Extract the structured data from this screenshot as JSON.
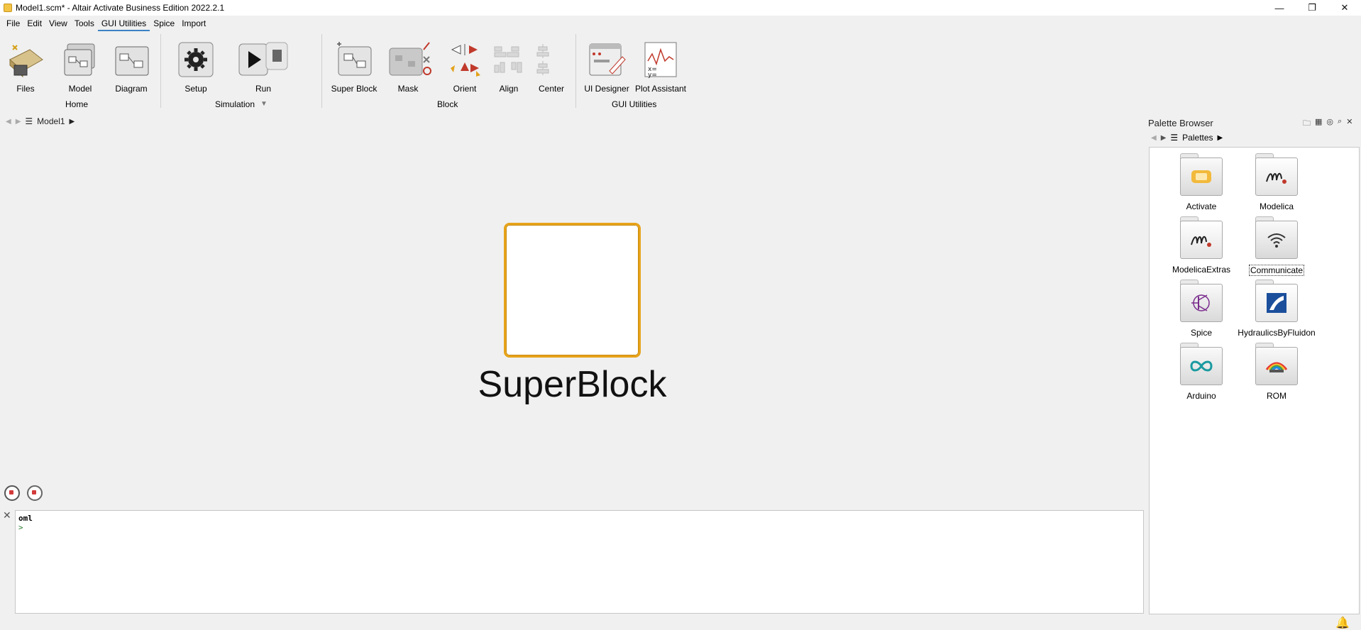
{
  "window": {
    "title": "Model1.scm* - Altair Activate Business Edition 2022.2.1",
    "controls": [
      "minimize-icon",
      "restore-icon",
      "close-icon"
    ]
  },
  "menu": [
    "File",
    "Edit",
    "View",
    "Tools",
    "GUI Utilities",
    "Spice",
    "Import"
  ],
  "ribbon": {
    "home": {
      "label": "Home",
      "buttons": [
        "Files",
        "Model",
        "Diagram"
      ]
    },
    "simulation": {
      "label": "Simulation",
      "buttons": [
        "Setup",
        "Run"
      ]
    },
    "block": {
      "label": "Block",
      "buttons": [
        "Super Block",
        "Mask",
        "Orient",
        "Align",
        "Center"
      ]
    },
    "gui_utilities": {
      "label": "GUI Utilities",
      "buttons": [
        "UI Designer",
        "Plot Assistant"
      ]
    }
  },
  "breadcrumb": {
    "item": "Model1"
  },
  "canvas": {
    "block_label": "SuperBlock",
    "block_border_color": "#e7a31a"
  },
  "console": {
    "title": "oml",
    "prompt": ">"
  },
  "palette": {
    "title": "Palette Browser",
    "breadcrumb": "Palettes",
    "items": [
      {
        "label": "Activate",
        "icon": "activate-icon"
      },
      {
        "label": "Modelica",
        "icon": "modelica-icon"
      },
      {
        "label": "ModelicaExtras",
        "icon": "modelica-extras-icon"
      },
      {
        "label": "Communicate",
        "icon": "wifi-icon"
      },
      {
        "label": "Spice",
        "icon": "transistor-icon"
      },
      {
        "label": "HydraulicsByFluidon",
        "icon": "fluidon-icon"
      },
      {
        "label": "Arduino",
        "icon": "infinity-icon"
      },
      {
        "label": "ROM",
        "icon": "rainbow-icon"
      }
    ]
  }
}
